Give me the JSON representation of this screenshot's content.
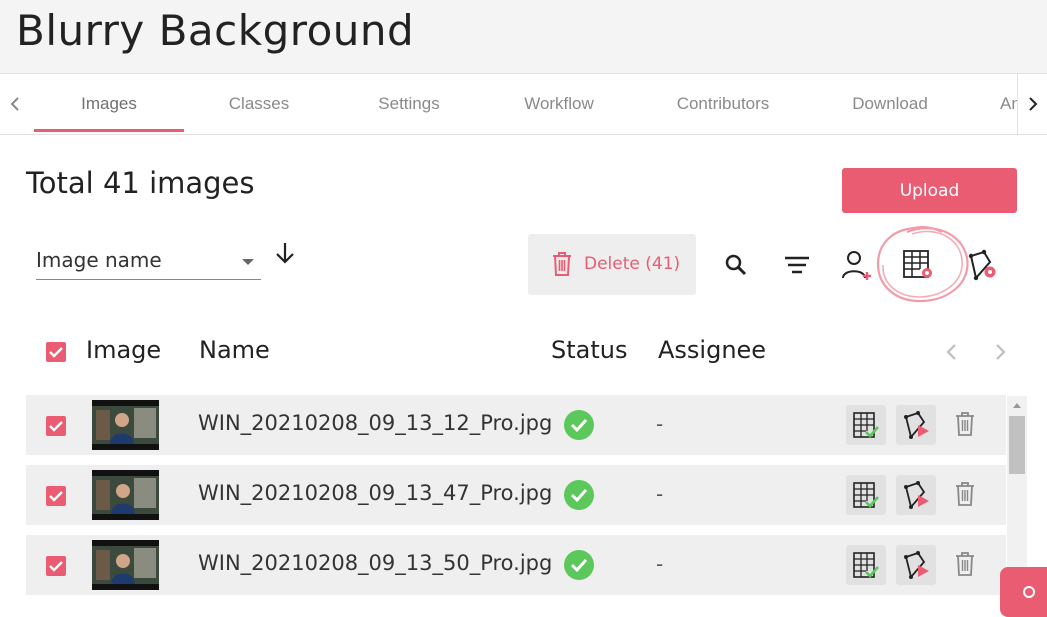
{
  "app": {
    "title": "Blurry Background"
  },
  "tabs": [
    {
      "label": "Images",
      "active": true
    },
    {
      "label": "Classes"
    },
    {
      "label": "Settings"
    },
    {
      "label": "Workflow"
    },
    {
      "label": "Contributors"
    },
    {
      "label": "Download"
    },
    {
      "label": "Analytics"
    }
  ],
  "summary": {
    "total_label": "Total 41 images"
  },
  "actions": {
    "upload_label": "Upload",
    "delete_label": "Delete (41)"
  },
  "sort": {
    "selected": "Image name",
    "direction": "descending"
  },
  "table": {
    "headers": {
      "image": "Image",
      "name": "Name",
      "status": "Status",
      "assignee": "Assignee"
    },
    "rows": [
      {
        "name": "WIN_20210208_09_13_12_Pro.jpg",
        "status": "completed",
        "assignee": "-",
        "checked": true
      },
      {
        "name": "WIN_20210208_09_13_47_Pro.jpg",
        "status": "completed",
        "assignee": "-",
        "checked": true
      },
      {
        "name": "WIN_20210208_09_13_50_Pro.jpg",
        "status": "completed",
        "assignee": "-",
        "checked": true
      }
    ]
  },
  "colors": {
    "accent": "#ea5c72",
    "success": "#5cc85c",
    "row_bg": "#efefef"
  },
  "icons": {
    "toolbar": [
      "search-icon",
      "filter-icon",
      "assign-user-icon",
      "classification-settings-icon",
      "annotation-settings-icon"
    ],
    "row_actions": [
      "classify-icon",
      "annotate-icon",
      "trash-icon"
    ]
  }
}
